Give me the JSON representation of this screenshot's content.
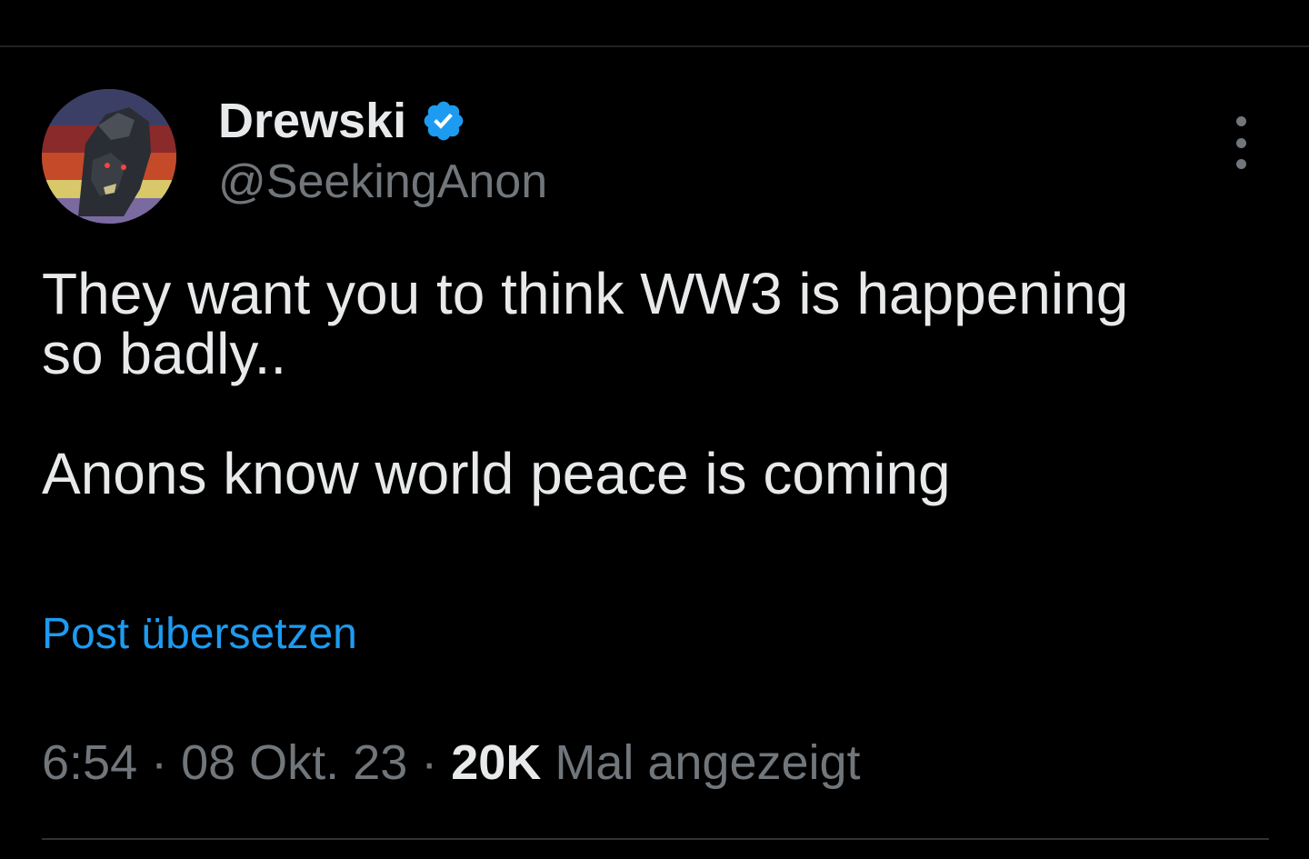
{
  "tweet": {
    "author": {
      "display_name": "Drewski",
      "handle": "@SeekingAnon",
      "verified": true
    },
    "text_lines": [
      "They want you to think WW3 is happening",
      "so badly..",
      "Anons know world peace is coming"
    ],
    "translate_label": "Post übersetzen",
    "meta": {
      "time": "6:54",
      "separator": " · ",
      "date": "08 Okt. 23",
      "views_count": "20K",
      "views_label": "Mal angezeigt"
    }
  },
  "colors": {
    "background": "#000000",
    "text_primary": "#e7e9ea",
    "text_secondary": "#71767b",
    "accent_blue": "#1d9bf0"
  },
  "icons": {
    "verified": "verified-badge-icon",
    "more": "more-dots-icon"
  }
}
